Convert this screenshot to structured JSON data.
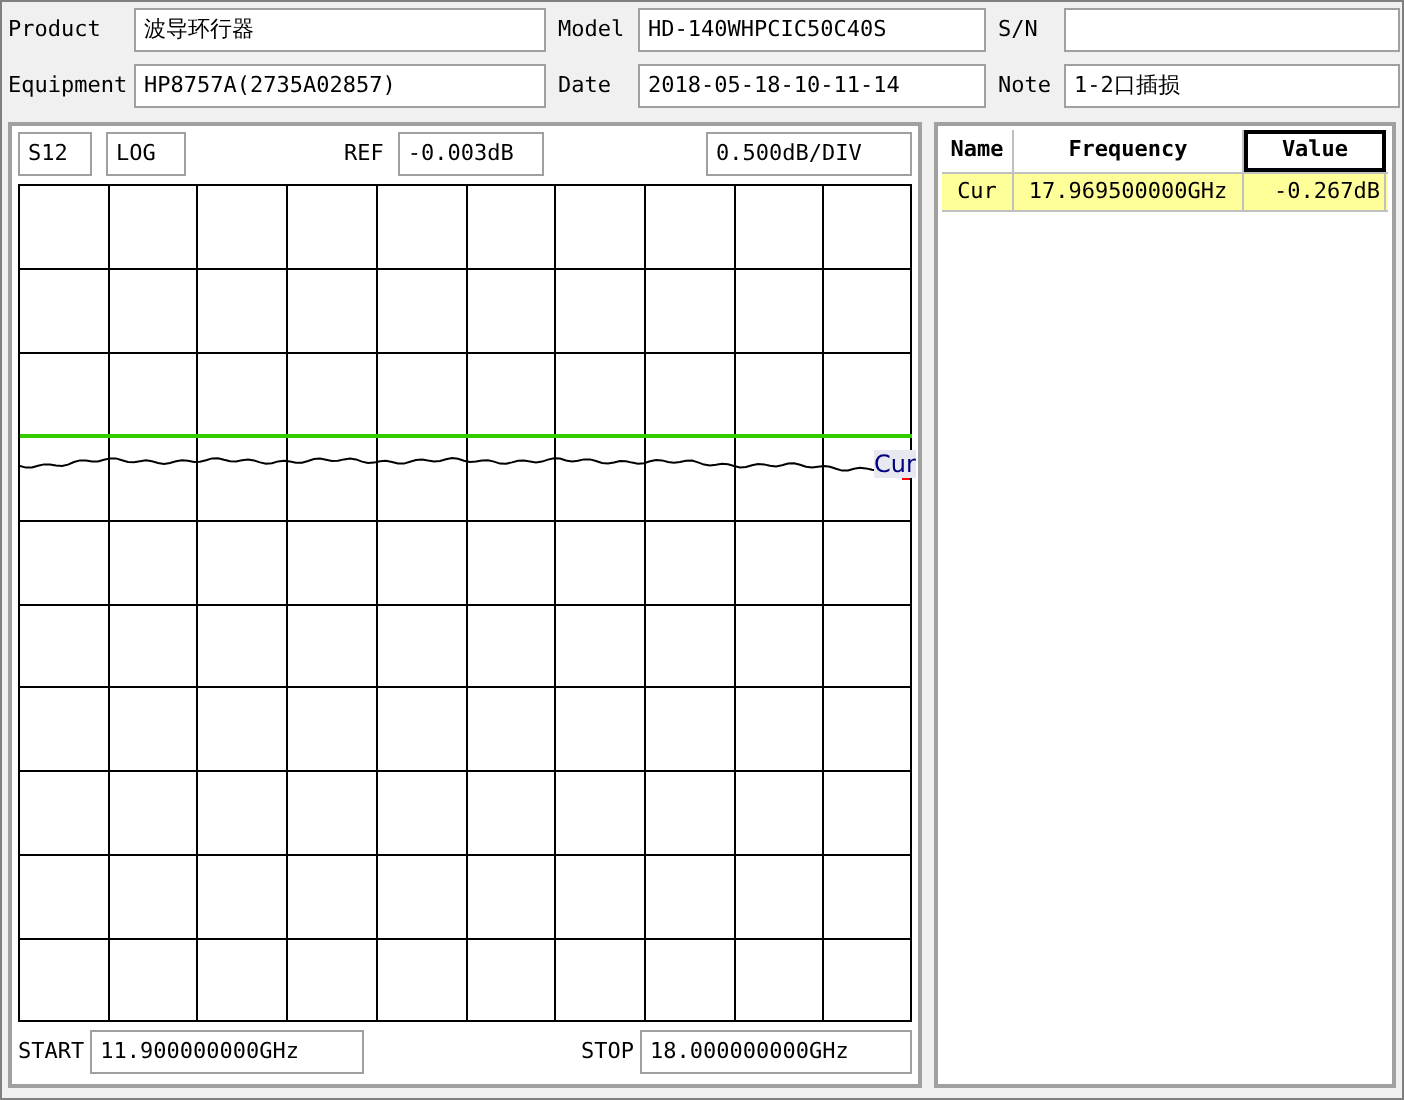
{
  "info_rows": [
    [
      {
        "label": "Product",
        "value": "波导环行器"
      },
      {
        "label": "Model",
        "value": "HD-140WHPCIC50C40S"
      },
      {
        "label": "S/N"
      }
    ],
    [
      {
        "label": "Equipment",
        "value": "HP8757A(2735A02857)"
      },
      {
        "label": "Date",
        "value": "2018-05-18-10-11-14"
      },
      {
        "label": "Note",
        "value": "1-2口插损"
      }
    ]
  ],
  "trace_bar": {
    "parameter": "S12",
    "format": "LOG",
    "ref_label": "REF",
    "ref_value": "-0.003dB",
    "scale": "0.500dB/DIV"
  },
  "plot": {
    "marker_label": "Cur"
  },
  "sweep": {
    "start_label": "START",
    "start_value": "11.900000000GHz",
    "stop_label": "STOP",
    "stop_value": "18.000000000GHz"
  },
  "marker_table": {
    "columns": [
      {
        "label": "Name",
        "selected": false
      },
      {
        "label": "Frequency",
        "selected": false
      },
      {
        "label": "Value",
        "selected": true
      }
    ],
    "rows": [
      {
        "cells": [
          "Cur",
          "17.969500000GHz",
          "-0.267dB"
        ],
        "selected": true
      }
    ]
  }
}
